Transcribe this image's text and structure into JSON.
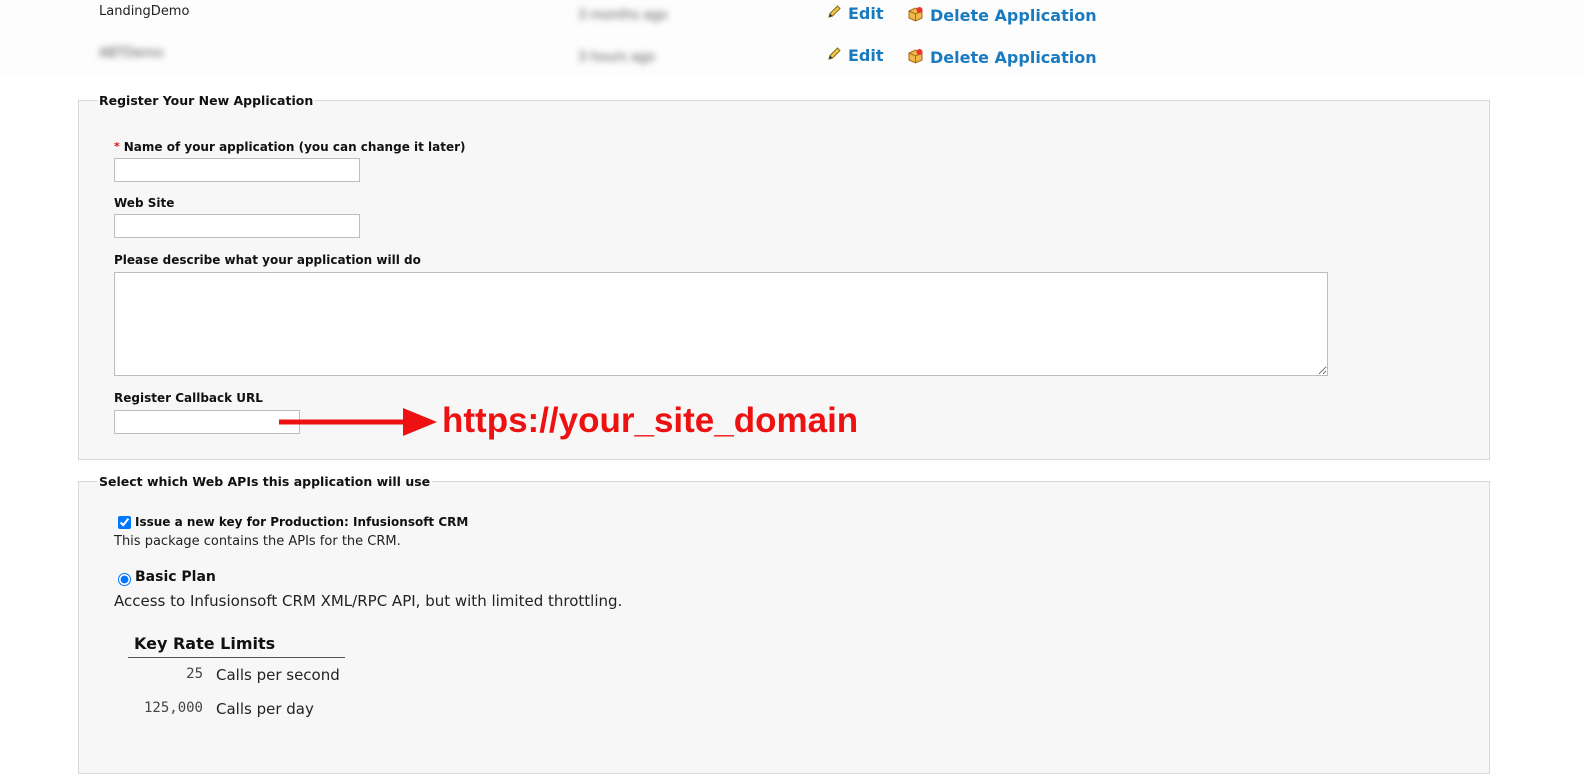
{
  "applications": [
    {
      "name": "LandingDemo",
      "meta": "3 months ago",
      "edit_label": "Edit",
      "delete_label": "Delete Application"
    },
    {
      "name": "ABTDemo",
      "meta": "3 hours ago",
      "edit_label": "Edit",
      "delete_label": "Delete Application"
    }
  ],
  "register_form": {
    "legend": "Register Your New Application",
    "required_mark": "*",
    "name_label": "Name of your application (you can change it later)",
    "name_value": "",
    "website_label": "Web Site",
    "website_value": "",
    "description_label": "Please describe what your application will do",
    "description_value": "",
    "callback_label": "Register Callback URL",
    "callback_value": ""
  },
  "annotation": {
    "text": "https://your_site_domain",
    "color": "#ee1111"
  },
  "apis": {
    "legend": "Select which Web APIs this application will use",
    "package_label": "Issue a new key for Production: Infusionsoft CRM",
    "package_checked": true,
    "package_description": "This package contains the APIs for the CRM.",
    "plan_label": "Basic Plan",
    "plan_selected": true,
    "plan_description": "Access to Infusionsoft CRM XML/RPC API, but with limited throttling.",
    "limits_header": "Key Rate Limits",
    "limits": [
      {
        "value": "25",
        "unit": "Calls per second"
      },
      {
        "value": "125,000",
        "unit": "Calls per day"
      }
    ]
  },
  "colors": {
    "link": "#1a7ac0",
    "panel_bg": "#f7f7f7",
    "required": "#dd1111"
  }
}
